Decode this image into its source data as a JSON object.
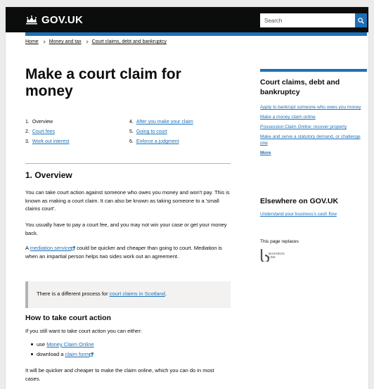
{
  "header": {
    "logo_text": "GOV.UK",
    "search_placeholder": "Search",
    "colors": {
      "header_bg": "#0b0c0c",
      "accent": "#1d70b8"
    }
  },
  "breadcrumb": [
    "Home",
    "Money and tax",
    "Court claims, debt and bankruptcy"
  ],
  "page_title": "Make a court claim for money",
  "contents": [
    {
      "num": "1.",
      "label": "Overview",
      "link": false
    },
    {
      "num": "4.",
      "label": "After you make your claim",
      "link": true
    },
    {
      "num": "2.",
      "label": "Court fees",
      "link": true
    },
    {
      "num": "5.",
      "label": "Going to court",
      "link": true
    },
    {
      "num": "3.",
      "label": "Work out interest",
      "link": true
    },
    {
      "num": "6.",
      "label": "Enforce a judgment",
      "link": true
    }
  ],
  "section": {
    "heading": "1. Overview",
    "p1": "You can take court action against someone who owes you money and won't pay. This is known as making a court claim. It can also be known as taking someone to a 'small claims court'.",
    "p2": "You usually have to pay a court fee, and you may not win your case or get your money back.",
    "p3_prefix": "A ",
    "p3_link": "mediation service",
    "p3_suffix": " could be quicker and cheaper than going to court. Mediation is when an impartial person helps two sides work out an agreement.",
    "inset_prefix": "There is a different process for ",
    "inset_link": "court claims in Scotland",
    "inset_suffix": ".",
    "subheading": "How to take court action",
    "p4": "If you still want to take court action you can either:",
    "bullet1_prefix": "use ",
    "bullet1_link": "Money Claim Online",
    "bullet2_prefix": "download a ",
    "bullet2_link": "claim form",
    "p5": "It will be quicker and cheaper to make the claim online, which you can do in most cases."
  },
  "sidebar": {
    "title": "Court claims, debt and bankruptcy",
    "links": [
      "Apply to bankrupt someone who owes you money",
      "Make a money claim online",
      "Possession Claim Online: recover property",
      "Make and serve a statutory demand, or challenge one"
    ],
    "more": "More",
    "elsewhere_title": "Elsewhere on GOV.UK",
    "elsewhere_link": "Understand your business's cash flow",
    "replaces_label": "This page replaces",
    "bl_logo_text": [
      "BUSINESS",
      "LINK"
    ]
  }
}
